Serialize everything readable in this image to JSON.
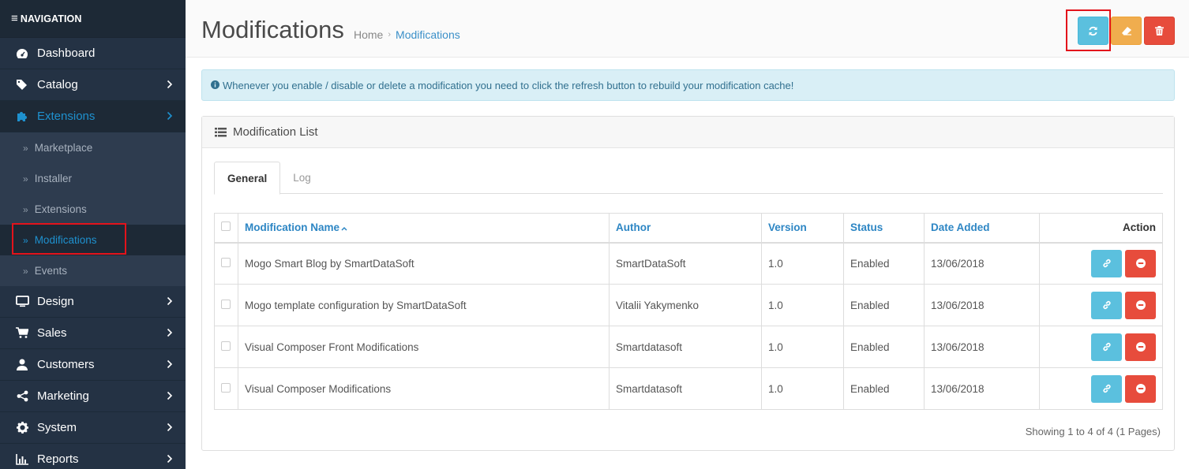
{
  "sidebar": {
    "header": "NAVIGATION",
    "menu": [
      {
        "label": "Dashboard",
        "icon": "dashboard-icon",
        "arrow": false
      },
      {
        "label": "Catalog",
        "icon": "tags-icon",
        "arrow": true
      },
      {
        "label": "Extensions",
        "icon": "puzzle-icon",
        "arrow": true,
        "active": true
      },
      {
        "label": "Design",
        "icon": "monitor-icon",
        "arrow": true
      },
      {
        "label": "Sales",
        "icon": "cart-icon",
        "arrow": true
      },
      {
        "label": "Customers",
        "icon": "user-icon",
        "arrow": true
      },
      {
        "label": "Marketing",
        "icon": "share-icon",
        "arrow": true
      },
      {
        "label": "System",
        "icon": "gear-icon",
        "arrow": true
      },
      {
        "label": "Reports",
        "icon": "bar-chart-icon",
        "arrow": true
      }
    ],
    "submenu": [
      {
        "label": "Marketplace"
      },
      {
        "label": "Installer"
      },
      {
        "label": "Extensions"
      },
      {
        "label": "Modifications",
        "active": true
      },
      {
        "label": "Events"
      }
    ]
  },
  "header": {
    "title": "Modifications",
    "breadcrumb": [
      "Home",
      "Modifications"
    ]
  },
  "alert": {
    "text": "Whenever you enable / disable or delete a modification you need to click the refresh button to rebuild your modification cache!"
  },
  "panel": {
    "title": "Modification List",
    "tabs": [
      "General",
      "Log"
    ]
  },
  "table": {
    "columns": [
      "Modification Name",
      "Author",
      "Version",
      "Status",
      "Date Added",
      "Action"
    ],
    "rows": [
      {
        "name": "Mogo Smart Blog by SmartDataSoft",
        "author": "SmartDataSoft",
        "version": "1.0",
        "status": "Enabled",
        "date": "13/06/2018"
      },
      {
        "name": "Mogo template configuration by SmartDataSoft",
        "author": "Vitalii Yakymenko",
        "version": "1.0",
        "status": "Enabled",
        "date": "13/06/2018"
      },
      {
        "name": "Visual Composer Front Modifications",
        "author": "Smartdatasoft",
        "version": "1.0",
        "status": "Enabled",
        "date": "13/06/2018"
      },
      {
        "name": "Visual Composer Modifications",
        "author": "Smartdatasoft",
        "version": "1.0",
        "status": "Enabled",
        "date": "13/06/2018"
      }
    ]
  },
  "pagination": {
    "text": "Showing 1 to 4 of 4 (1 Pages)"
  },
  "colors": {
    "accent": "#1e91cf",
    "info": "#5bc0de",
    "warning": "#f0ad4e",
    "danger": "#e74c3c",
    "highlight": "#e3131b"
  }
}
